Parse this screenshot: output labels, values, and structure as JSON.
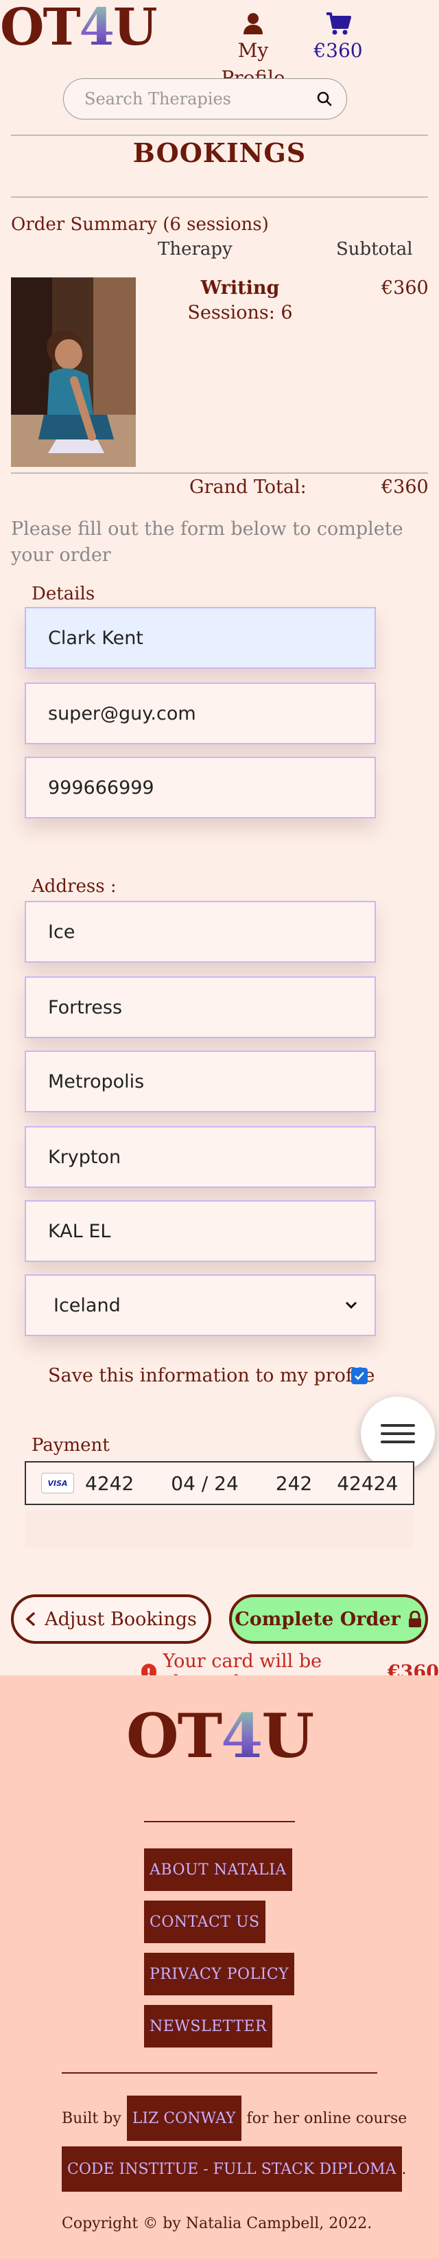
{
  "header": {
    "logo_prefix": "OT",
    "logo_four": "4",
    "logo_suffix": "U",
    "profile_label": "My Profile",
    "bag_total": "€360",
    "search_placeholder": "Search Therapies"
  },
  "page_title": "BOOKINGS",
  "order": {
    "summary_label": "Order Summary (6 sessions)",
    "col_therapy": "Therapy",
    "col_subtotal": "Subtotal",
    "item_name": "Writing",
    "item_sessions": "Sessions: 6",
    "item_subtotal": "€360",
    "grand_total_label": "Grand Total:",
    "grand_total_value": "€360"
  },
  "form": {
    "intro": "Please fill out the form below to complete your order",
    "details_label": "Details",
    "full_name": "Clark Kent",
    "email": "super@guy.com",
    "phone": "999666999",
    "address_label": "Address :",
    "street1": "Ice",
    "street2": "Fortress",
    "town": "Metropolis",
    "county": "Krypton",
    "postcode": "KAL EL",
    "country": "Iceland",
    "save_info_label": "Save this information to my profile",
    "save_info_checked": true,
    "payment_label": "Payment",
    "card_brand": "VISA",
    "card_number": "4242",
    "card_expiry": "04 / 24",
    "card_cvc": "242",
    "card_zip": "42424"
  },
  "actions": {
    "adjust_label": "Adjust Bookings",
    "complete_label": "Complete Order",
    "charge_prefix": "Your card will be charged",
    "charge_amount": "€360"
  },
  "footer": {
    "logo_prefix": "OT",
    "logo_four": "4",
    "logo_suffix": "U",
    "links": [
      "ABOUT NATALIA",
      "CONTACT US",
      "PRIVACY POLICY",
      "NEWSLETTER"
    ],
    "built_by_prefix": "Built by",
    "built_by_name": "LIZ CONWAY",
    "built_by_suffix": "for her online course",
    "course": "CODE INSTITUE - FULL STACK DIPLOMA",
    "course_suffix": ".",
    "copyright": "Copyright © by Natalia Campbell, 2022."
  },
  "colors": {
    "brand": "#6b1a0c",
    "accent_purple": "#7b5fc7",
    "complete_button": "#98f59a",
    "footer_bg": "#ffcdbd",
    "page_bg": "#fdeee8",
    "error_red": "#c4261d"
  },
  "icons": {
    "profile": "user-icon",
    "bag": "shopping-cart-icon",
    "search": "search-icon",
    "menu": "hamburger-menu-icon",
    "lock": "lock-icon",
    "back": "chevron-left-icon",
    "warning": "exclamation-circle-icon"
  }
}
